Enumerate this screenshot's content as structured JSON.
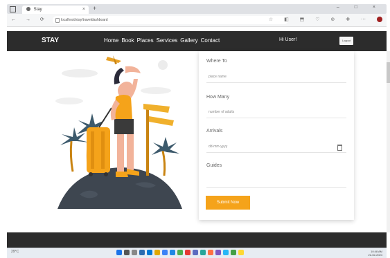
{
  "browser": {
    "tab_title": "Stay",
    "tab_close": "×",
    "new_tab": "+",
    "window_controls": "– □ ×",
    "nav_buttons": "← → ⟳ ⌂",
    "url": "localhost/stay/traveldashboard",
    "ext_icons": "☆ ◧ ⬒ ♡ ⊕ ✚ ⋯"
  },
  "navbar": {
    "brand": "STAY",
    "links": [
      "Home",
      "Book",
      "Places",
      "Services",
      "Gallery",
      "Contact"
    ],
    "user_greeting": "Hi User!",
    "logout_label": "Logout"
  },
  "form": {
    "where_label": "Where To",
    "where_placeholder": "place name",
    "how_many_label": "How Many",
    "how_many_placeholder": "number of adults",
    "arrivals_label": "Arrivals",
    "arrivals_value": "dd-mm-yyyy",
    "guides_label": "Guides",
    "guides_value": "",
    "submit_label": "Submit Now"
  },
  "taskbar": {
    "weather": "29°C",
    "time": "10:48 AM",
    "date": "22-02-2024"
  },
  "colors": {
    "navbar_bg": "#2c2c2c",
    "accent": "#f5a31a"
  }
}
